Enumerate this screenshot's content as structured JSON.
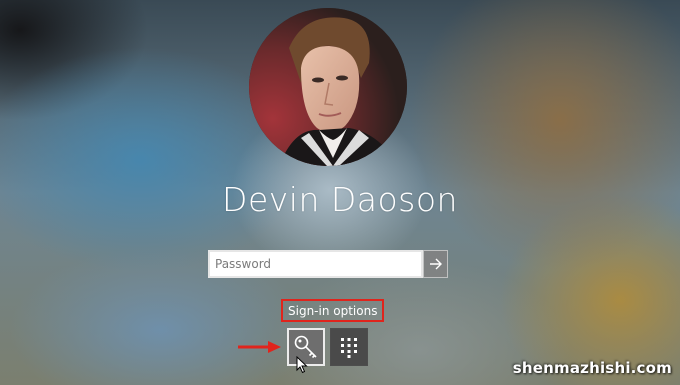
{
  "lock_screen": {
    "user_name": "Devin Daoson",
    "password": {
      "placeholder": "Password",
      "value": ""
    },
    "submit_icon": "arrow-right-icon",
    "sign_in_options_label": "Sign-in options",
    "sign_in_options": [
      {
        "icon": "key-icon",
        "selected": true
      },
      {
        "icon": "pin-keypad-icon",
        "selected": false
      }
    ],
    "annotation_color": "#e0241c"
  },
  "watermark": "shenmazhishi.com"
}
